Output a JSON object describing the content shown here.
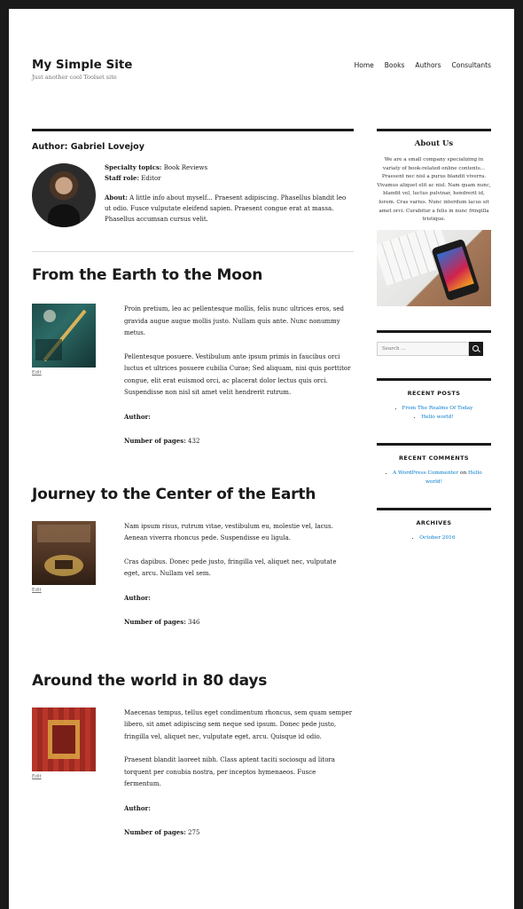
{
  "site": {
    "title": "My Simple Site",
    "description": "Just another cool Toolset site"
  },
  "nav": {
    "items": [
      {
        "label": "Home"
      },
      {
        "label": "Books"
      },
      {
        "label": "Authors"
      },
      {
        "label": "Consultants"
      }
    ]
  },
  "author": {
    "heading": "Author: Gabriel Lovejoy",
    "specialty_label": "Specialty topics:",
    "specialty_value": "Book Reviews",
    "staff_label": "Staff role:",
    "staff_value": "Editor",
    "about_label": "About:",
    "about_text": "A little info about myself... Praesent adipiscing. Phasellus blandit leo ut odio. Fusce vulputate eleifend sapien. Praesent congue erat at massa. Phasellus accumsan cursus velit."
  },
  "books": [
    {
      "title": "From the Earth to the Moon",
      "edit": "Edit",
      "paragraphs": [
        "Proin pretium, leo ac pellentesque mollis, felis nunc ultrices eros, sed gravida augue augue mollis justo. Nullam quis ante. Nunc nonummy metus.",
        "Pellentesque posuere. Vestibulum ante ipsum primis in faucibus orci luctus et ultrices posuere cubilia Curae; Sed aliquam, nisi quis porttitor congue, elit erat euismod orci, ac placerat dolor lectus quis orci. Suspendisse non nisl sit amet velit hendrerit rutrum."
      ],
      "author_label": "Author:",
      "pages_label": "Number of pages:",
      "pages": "432"
    },
    {
      "title": "Journey to the Center of the Earth",
      "edit": "Edit",
      "paragraphs": [
        "Nam ipsum risus, rutrum vitae, vestibulum eu, molestie vel, lacus. Aenean viverra rhoncus pede. Suspendisse eu ligula.",
        "Cras dapibus. Donec pede justo, fringilla vel, aliquet nec, vulputate eget, arcu. Nullam vel sem."
      ],
      "author_label": "Author:",
      "pages_label": "Number of pages:",
      "pages": "346"
    },
    {
      "title": "Around the world in 80 days",
      "edit": "Edit",
      "paragraphs": [
        "Maecenas tempus, tellus eget condimentum rhoncus, sem quam semper libero, sit amet adipiscing sem neque sed ipsum. Donec pede justo, fringilla vel, aliquet nec, vulputate eget, arcu. Quisque id odio.",
        "Praesent blandit laoreet nibh. Class aptent taciti sociosqu ad litora torquent per conubia nostra, per inceptos hymenaeos. Fusce fermentum."
      ],
      "author_label": "Author:",
      "pages_label": "Number of pages:",
      "pages": "275"
    }
  ],
  "sidebar": {
    "about": {
      "title": "About Us",
      "text": "We are a small company specializing in variaty of book-related online contents... Praesent nec nisl a purus blandit viverra. Vivamus aliquet elit ac nisl. Nam quam nunc, blandit vel, luctus pulvinar, hendrerit id, lorem. Cras varius. Nunc interdum lacus sit amet orci. Curabitur a felis in nunc fringilla tristique."
    },
    "search": {
      "placeholder": "Search …",
      "icon": "search-icon"
    },
    "recent_posts": {
      "title": "RECENT POSTS",
      "items": [
        "From The Realms Of Today",
        "Hello world!"
      ]
    },
    "recent_comments": {
      "title": "RECENT COMMENTS",
      "commenter": "A WordPress Commenter",
      "on": "on",
      "post": "Hello world!"
    },
    "archives": {
      "title": "ARCHIVES",
      "items": [
        "October 2016"
      ]
    }
  },
  "colors": {
    "link": "#007acc",
    "text": "#1a1a1a",
    "frame": "#1a1a1a"
  }
}
